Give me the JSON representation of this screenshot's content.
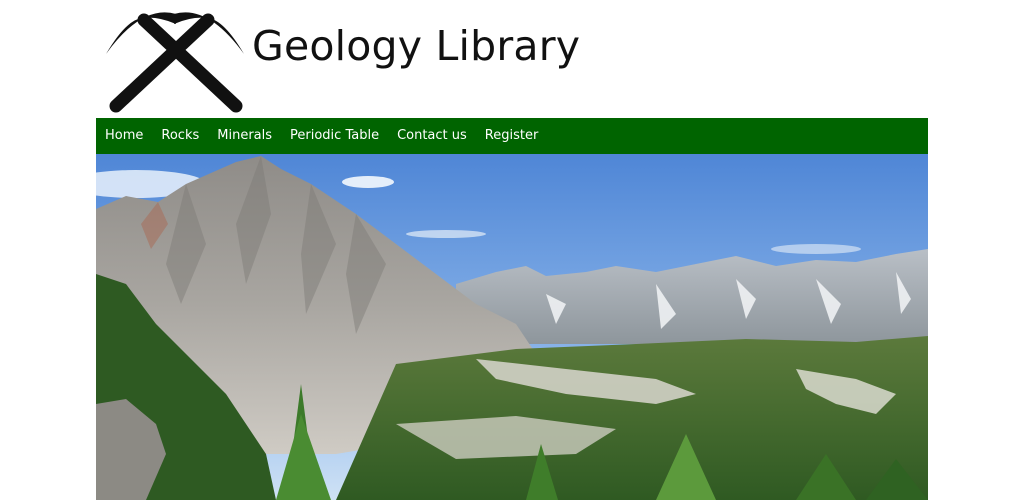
{
  "site": {
    "title": "Geology Library",
    "logo_icon": "crossed-pickaxes-icon"
  },
  "nav": {
    "items": [
      {
        "label": "Home"
      },
      {
        "label": "Rocks"
      },
      {
        "label": "Minerals"
      },
      {
        "label": "Periodic Table"
      },
      {
        "label": "Contact us"
      },
      {
        "label": "Register"
      }
    ]
  },
  "hero": {
    "image": "mountain-valley-landscape"
  },
  "colors": {
    "nav_background": "#006400",
    "nav_text": "#ffffff",
    "title_text": "#111111"
  }
}
